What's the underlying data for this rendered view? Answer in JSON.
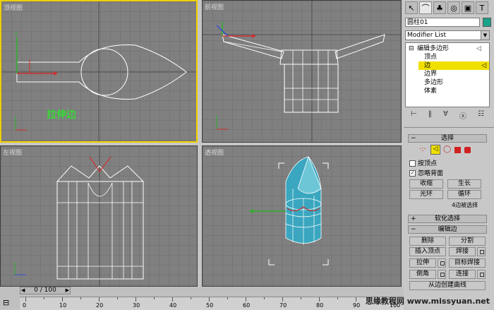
{
  "viewports": {
    "top_label": "顶视图",
    "front_label": "前视图",
    "left_label": "左视图",
    "persp_label": "透视图",
    "annotation": "拉伸边"
  },
  "command_panel": {
    "tab_icons": [
      "select-icon",
      "modify-icon",
      "hierarchy-icon",
      "motion-icon",
      "display-icon",
      "utilities-icon"
    ],
    "object_name": "圆柱01",
    "object_color": "#1aa38a",
    "modifier_list": "Modifier List",
    "stack": {
      "root": "编辑多边形",
      "items": [
        "顶点",
        "边",
        "边界",
        "多边形",
        "体素"
      ],
      "selected_index": 1
    },
    "selection_rollout": {
      "title": "选择",
      "by_vertex": "按顶点",
      "ignore_backfacing": "忽略背面",
      "shrink": "收缩",
      "grow": "生长",
      "ring": "光环",
      "loop": "循环",
      "status": "4边被选择"
    },
    "soft_selection_title": "软化选择",
    "edit_edges": {
      "title": "编辑边",
      "remove": "删除",
      "split": "分割",
      "insert_vertex": "插入顶点",
      "weld": "焊接",
      "extrude": "拉伸",
      "target_weld": "目标焊接",
      "chamfer": "倒角",
      "connect": "连接",
      "create_shape": "从边创建曲线"
    }
  },
  "timeline": {
    "frame_display": "0 / 100",
    "ticks": [
      "0",
      "10",
      "20",
      "30",
      "40",
      "50",
      "60",
      "70",
      "80",
      "90",
      "100"
    ]
  },
  "watermark": "思缘教程网 www.missyuan.net"
}
